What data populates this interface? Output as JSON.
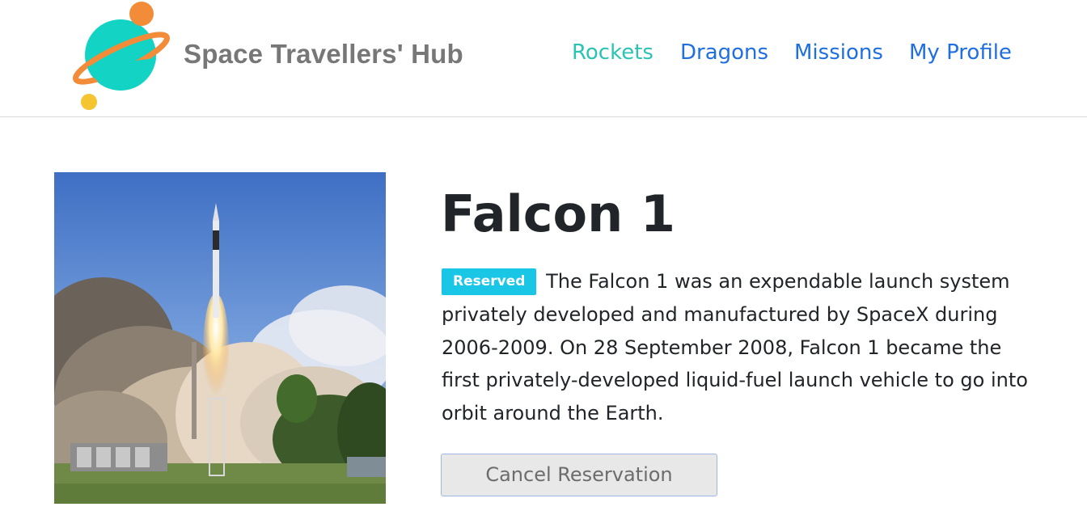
{
  "header": {
    "brand": "Space Travellers' Hub",
    "logo_icon": "planet-logo-icon",
    "nav": [
      {
        "label": "Rockets",
        "active": true
      },
      {
        "label": "Dragons",
        "active": false
      },
      {
        "label": "Missions",
        "active": false
      },
      {
        "label": "My Profile",
        "active": false
      }
    ]
  },
  "rocket": {
    "name": "Falcon 1",
    "status_badge": "Reserved",
    "description": "The Falcon 1 was an expendable launch system privately developed and manufactured by SpaceX during 2006-2009. On 28 September 2008, Falcon 1 became the first privately-developed liquid-fuel launch vehicle to go into orbit around the Earth.",
    "image_alt": "rocket-launch-photo",
    "action_label": "Cancel Reservation"
  },
  "colors": {
    "nav_link": "#1f6fe0",
    "nav_active": "#2bc3b4",
    "badge": "#19c6e6",
    "brand_text": "#777777"
  }
}
